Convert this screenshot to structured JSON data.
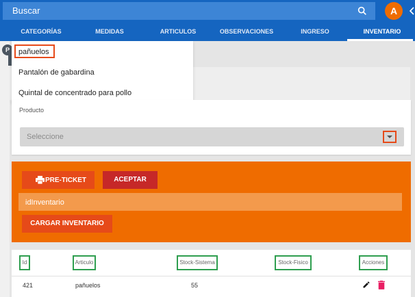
{
  "search": {
    "placeholder": "Buscar",
    "icon": "search-icon"
  },
  "user": {
    "avatar_letter": "A"
  },
  "tabs": [
    {
      "label": "CATEGORÍAS",
      "active": false
    },
    {
      "label": "MEDIDAS",
      "active": false
    },
    {
      "label": "ARTICULOS",
      "active": false
    },
    {
      "label": "OBSERVACIONES",
      "active": false
    },
    {
      "label": "INGRESO",
      "active": false
    },
    {
      "label": "INVENTARIO",
      "active": true
    }
  ],
  "background": {
    "circle_letter": "P"
  },
  "dropdown": {
    "items": [
      "pañuelos",
      "Pantalón de gabardina",
      "Quintal de concentrado para pollo"
    ],
    "highlighted_index": 0
  },
  "producto": {
    "label": "Producto",
    "select_value": "Seleccione"
  },
  "actions": {
    "preticket_label": "PRE-TICKET",
    "aceptar_label": "ACEPTAR",
    "id_inventario_placeholder": "idInventario",
    "cargar_label": "CARGAR INVENTARIO"
  },
  "table": {
    "headers": [
      "Id",
      "Articulo",
      "Stock-Sistema",
      "Stock-Fisico",
      "Acciones"
    ],
    "rows": [
      {
        "id": "421",
        "articulo": "pañuelos",
        "stock_sistema": "55",
        "stock_fisico": ""
      }
    ]
  },
  "colors": {
    "primary": "#1565c0",
    "orange_panel": "#ef6c00",
    "button_deep_orange": "#e64a19",
    "button_red": "#c62828",
    "highlight_box": "#e64a19",
    "header_box": "#2e9e4f",
    "delete_icon": "#e91e63"
  }
}
